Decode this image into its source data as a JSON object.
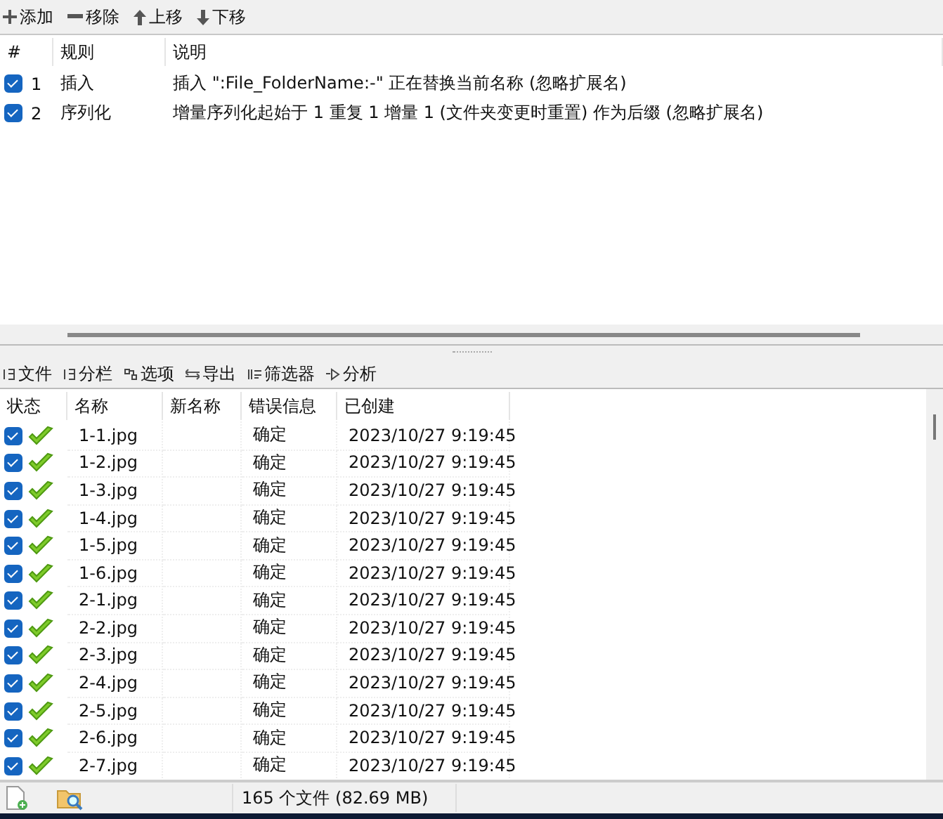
{
  "toolbar": [
    {
      "label": "添加",
      "kind": "add"
    },
    {
      "label": "移除",
      "kind": "remove"
    },
    {
      "label": "上移",
      "kind": "up"
    },
    {
      "label": "下移",
      "kind": "down"
    }
  ],
  "rules": {
    "columns": [
      "#",
      "规则",
      "说明"
    ],
    "rows": [
      {
        "checked": true,
        "index": "1",
        "rule": "插入",
        "description": "插入 \":File_FolderName:-\" 正在替换当前名称 (忽略扩展名)"
      },
      {
        "checked": true,
        "index": "2",
        "rule": "序列化",
        "description": "增量序列化起始于 1 重复 1 增量 1 (文件夹变更时重置) 作为后缀 (忽略扩展名)"
      }
    ]
  },
  "file_toolbar": [
    {
      "label": "文件",
      "kind": "files"
    },
    {
      "label": "分栏",
      "kind": "columns"
    },
    {
      "label": "选项",
      "kind": "options"
    },
    {
      "label": "导出",
      "kind": "export"
    },
    {
      "label": "筛选器",
      "kind": "filter"
    },
    {
      "label": "分析",
      "kind": "analyze"
    }
  ],
  "files": {
    "columns": [
      "状态",
      "名称",
      "新名称",
      "错误信息",
      "已创建"
    ],
    "rows": [
      {
        "checked": true,
        "name": "1-1.jpg",
        "new_name": "",
        "error": "确定",
        "created": "2023/10/27 9:19:45"
      },
      {
        "checked": true,
        "name": "1-2.jpg",
        "error": "确定",
        "created": "2023/10/27 9:19:45"
      },
      {
        "checked": true,
        "name": "1-3.jpg",
        "error": "确定",
        "created": "2023/10/27 9:19:45"
      },
      {
        "checked": true,
        "name": "1-4.jpg",
        "error": "确定",
        "created": "2023/10/27 9:19:45"
      },
      {
        "checked": true,
        "name": "1-5.jpg",
        "error": "确定",
        "created": "2023/10/27 9:19:45"
      },
      {
        "checked": true,
        "name": "1-6.jpg",
        "error": "确定",
        "created": "2023/10/27 9:19:45"
      },
      {
        "checked": true,
        "name": "2-1.jpg",
        "error": "确定",
        "created": "2023/10/27 9:19:45"
      },
      {
        "checked": true,
        "name": "2-2.jpg",
        "error": "确定",
        "created": "2023/10/27 9:19:45"
      },
      {
        "checked": true,
        "name": "2-3.jpg",
        "error": "确定",
        "created": "2023/10/27 9:19:45"
      },
      {
        "checked": true,
        "name": "2-4.jpg",
        "error": "确定",
        "created": "2023/10/27 9:19:45"
      },
      {
        "checked": true,
        "name": "2-5.jpg",
        "error": "确定",
        "created": "2023/10/27 9:19:45"
      },
      {
        "checked": true,
        "name": "2-6.jpg",
        "error": "确定",
        "created": "2023/10/27 9:19:45"
      },
      {
        "checked": true,
        "name": "2-7.jpg",
        "error": "确定",
        "created": "2023/10/27 9:19:45"
      }
    ]
  },
  "status_bar": {
    "file_count": "165 个文件 (82.69 MB)"
  }
}
